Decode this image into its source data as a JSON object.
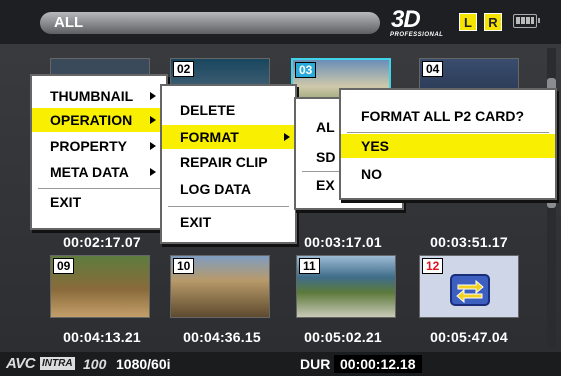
{
  "top_bar": {
    "filter_label": "ALL",
    "logo_text": "3D",
    "logo_subtext": "PROFESSIONAL",
    "channel_left": "L",
    "channel_right": "R"
  },
  "clips": [
    {
      "number": "",
      "timecode": "00:02:17.07"
    },
    {
      "number": "02",
      "timecode": ""
    },
    {
      "number": "03",
      "timecode": "00:03:17.01",
      "selected": true
    },
    {
      "number": "04",
      "timecode": "00:03:51.17"
    },
    {
      "number": "09",
      "timecode": "00:04:13.21"
    },
    {
      "number": "10",
      "timecode": "00:04:36.15"
    },
    {
      "number": "11",
      "timecode": "00:05:02.21"
    },
    {
      "number": "12",
      "timecode": "00:05:47.04",
      "number_color": "#e0141d"
    }
  ],
  "main_menu": {
    "items": [
      "THUMBNAIL",
      "OPERATION",
      "PROPERTY",
      "META DATA",
      "EXIT"
    ],
    "highlighted": "OPERATION",
    "highlight_color": "#f8f000"
  },
  "operation_menu": {
    "items": [
      "DELETE",
      "FORMAT",
      "REPAIR CLIP",
      "LOG DATA",
      "EXIT"
    ],
    "highlighted": "FORMAT"
  },
  "format_menu": {
    "items": [
      "AL",
      "SD",
      "EX"
    ]
  },
  "confirm_dialog": {
    "question": "FORMAT ALL P2 CARD?",
    "options": [
      "YES",
      "NO"
    ],
    "highlighted": "YES"
  },
  "bottom_bar": {
    "codec_brand": "AVC",
    "codec_badge": "INTRA",
    "codec_bitrate": "100",
    "format": "1080/60i",
    "duration_label": "DUR",
    "duration_value": "00:00:12.18"
  },
  "colors": {
    "selection_border": "#41d3e8",
    "menu_highlight": "#f8f000",
    "channel_badge": "#f7e300"
  }
}
